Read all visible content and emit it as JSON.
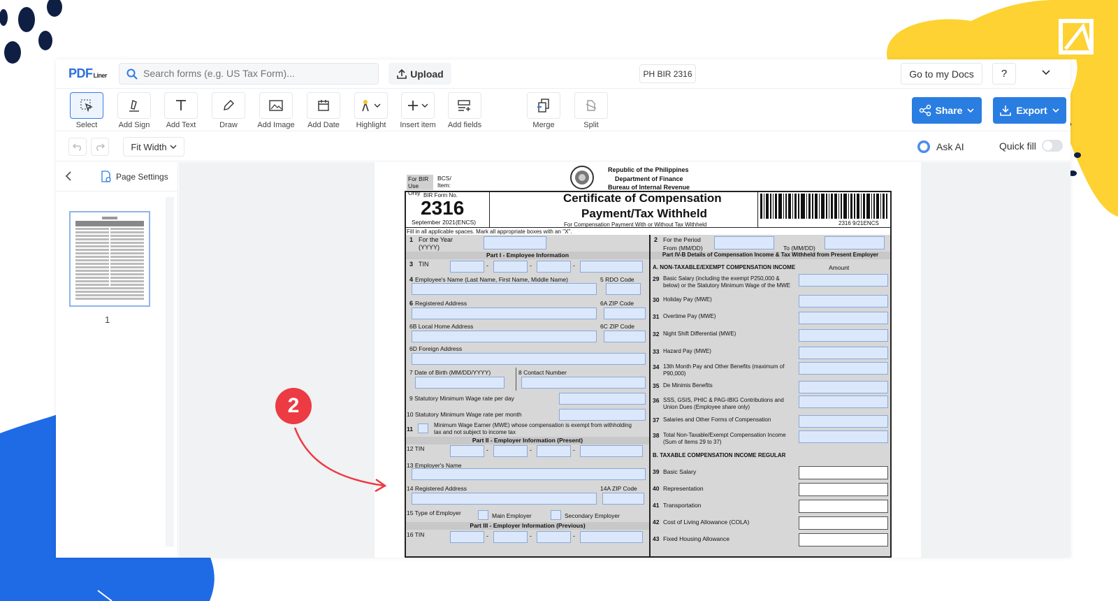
{
  "app": {
    "logo_main": "PDF",
    "logo_sub": "Liner",
    "search_placeholder": "Search forms (e.g. US Tax Form)...",
    "upload_label": "Upload",
    "document_name": "PH BIR 2316",
    "go_to_docs_label": "Go to my Docs",
    "help_label": "?"
  },
  "toolbar": {
    "tools": [
      {
        "label": "Select",
        "icon": "select-cursor-icon"
      },
      {
        "label": "Add Sign",
        "icon": "sign-pen-icon"
      },
      {
        "label": "Add Text",
        "icon": "text-t-icon"
      },
      {
        "label": "Draw",
        "icon": "draw-pen-icon"
      },
      {
        "label": "Add Image",
        "icon": "image-icon"
      },
      {
        "label": "Add Date",
        "icon": "calendar-icon"
      },
      {
        "label": "Highlight",
        "icon": "highlight-icon"
      },
      {
        "label": "Insert item",
        "icon": "plus-icon"
      },
      {
        "label": "Add fields",
        "icon": "fields-icon"
      },
      {
        "label": "Merge",
        "icon": "merge-icon"
      },
      {
        "label": "Split",
        "icon": "split-icon"
      }
    ],
    "share_label": "Share",
    "export_label": "Export"
  },
  "subbar": {
    "zoom_label": "Fit Width",
    "ask_ai_label": "Ask AI",
    "quick_fill_label": "Quick fill"
  },
  "sidebar": {
    "page_settings_label": "Page Settings",
    "thumbnail_page_number": "1"
  },
  "form": {
    "for_bir_label": "For BIR Use Only",
    "bcs_label": "BCS/ Item:",
    "header_line1": "Republic of the Philippines",
    "header_line2": "Department of Finance",
    "header_line3": "Bureau of Internal Revenue",
    "form_no_label": "BIR Form No.",
    "form_no": "2316",
    "form_date": "September 2021(ENCS)",
    "title_line1": "Certificate of Compensation",
    "title_line2": "Payment/Tax Withheld",
    "subtitle": "For Compensation Payment With or Without Tax Withheld",
    "barcode_code": "2316 9/21ENCS",
    "instructions": "Fill in all applicable spaces. Mark all appropriate boxes with an \"X\".",
    "item1": "For the Year (YYYY)",
    "item2": "For the Period",
    "item2_from": "From (MM/DD)",
    "item2_to": "To (MM/DD)",
    "part1": "Part I - Employee Information",
    "part4b": "Part IV-B Details of Compensation Income & Tax Withheld from Present Employer",
    "item3": "TIN",
    "item4": "Employee's Name (Last Name, First Name, Middle Name)",
    "item5": "RDO Code",
    "item6": "Registered Address",
    "item6a": "ZIP Code",
    "item6b": "Local Home Address",
    "item6c": "ZIP Code",
    "item6d": "Foreign Address",
    "item7": "Date of Birth (MM/DD/YYYY)",
    "item8": "Contact Number",
    "item9": "Statutory Minimum Wage rate per day",
    "item10": "Statutory Minimum Wage rate per month",
    "item11": "Minimum Wage Earner (MWE) whose compensation is exempt from withholding tax and not subject to income tax",
    "part2": "Part II - Employer Information (Present)",
    "item12": "TIN",
    "item13": "Employer's Name",
    "item14": "Registered Address",
    "item14a": "ZIP Code",
    "item15": "Type of Employer",
    "main_employer": "Main Employer",
    "secondary_employer": "Secondary Employer",
    "part3": "Part III - Employer Information (Previous)",
    "item16": "TIN",
    "sectionA": "A. NON-TAXABLE/EXEMPT COMPENSATION INCOME",
    "amount_label": "Amount",
    "right_items": [
      {
        "no": "29",
        "label": "Basic Salary (including the exempt P250,000 & below) or the Statutory Minimum Wage of the MWE"
      },
      {
        "no": "30",
        "label": "Holiday Pay (MWE)"
      },
      {
        "no": "31",
        "label": "Overtime Pay (MWE)"
      },
      {
        "no": "32",
        "label": "Night Shift Differential (MWE)"
      },
      {
        "no": "33",
        "label": "Hazard Pay (MWE)"
      },
      {
        "no": "34",
        "label": "13th Month Pay and Other Benefits (maximum of P90,000)"
      },
      {
        "no": "35",
        "label": "De Minimis Benefits"
      },
      {
        "no": "36",
        "label": "SSS, GSIS, PHIC & PAG-IBIG Contributions and Union Dues (Employee share only)"
      },
      {
        "no": "37",
        "label": "Salaries and Other Forms of Compensation"
      },
      {
        "no": "38",
        "label": "Total Non-Taxable/Exempt Compensation Income (Sum of Items 29 to 37)"
      }
    ],
    "sectionB": "B. TAXABLE COMPENSATION INCOME REGULAR",
    "right_items_b": [
      {
        "no": "39",
        "label": "Basic Salary"
      },
      {
        "no": "40",
        "label": "Representation"
      },
      {
        "no": "41",
        "label": "Transportation"
      },
      {
        "no": "42",
        "label": "Cost of Living Allowance (COLA)"
      },
      {
        "no": "43",
        "label": "Fixed Housing Allowance"
      }
    ]
  },
  "annotation": {
    "step_number": "2"
  },
  "colors": {
    "accent": "#2a7de1",
    "badge": "#ec3b43",
    "field": "#dbe8fb",
    "deco_yellow": "#fdd232",
    "deco_blue": "#1f6be6"
  }
}
